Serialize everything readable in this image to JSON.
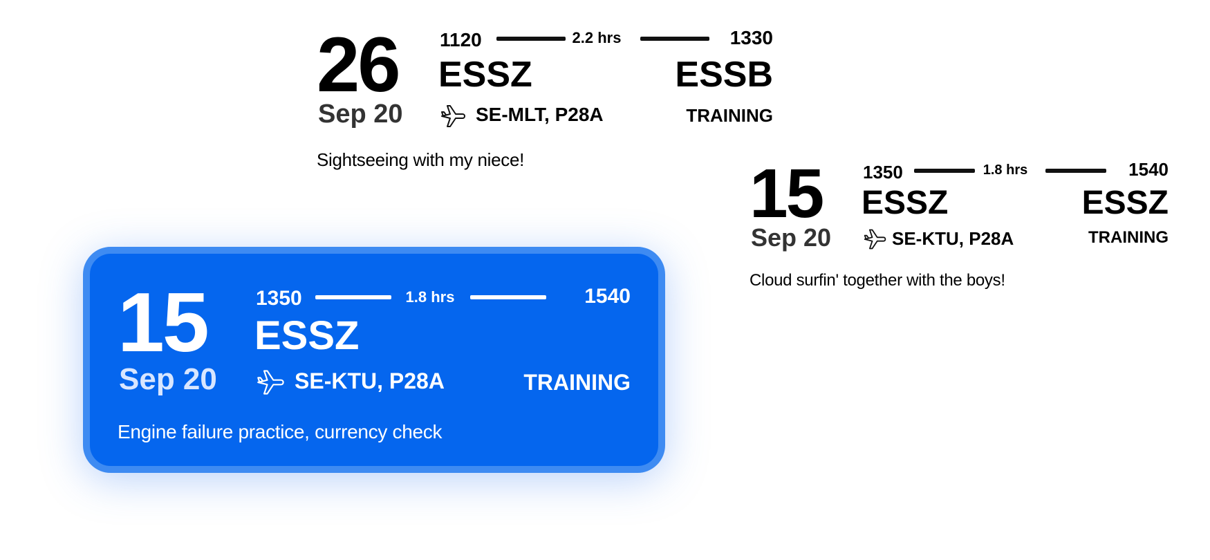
{
  "flights": [
    {
      "day": "26",
      "month": "Sep 20",
      "departure_time": "1120",
      "duration": "2.2 hrs",
      "arrival_time": "1330",
      "departure_code": "ESSZ",
      "arrival_code": "ESSB",
      "aircraft": "SE-MLT, P28A",
      "flight_type": "TRAINING",
      "note": "Sightseeing with my niece!",
      "selected": false
    },
    {
      "day": "15",
      "month": "Sep 20",
      "departure_time": "1350",
      "duration": "1.8 hrs",
      "arrival_time": "1540",
      "departure_code": "ESSZ",
      "arrival_code": "ESSZ",
      "aircraft": "SE-KTU, P28A",
      "flight_type": "TRAINING",
      "note": "Cloud surfin' together with the boys!",
      "selected": false
    },
    {
      "day": "15",
      "month": "Sep 20",
      "departure_time": "1350",
      "duration": "1.8 hrs",
      "arrival_time": "1540",
      "departure_code": "ESSZ",
      "aircraft": "SE-KTU, P28A",
      "flight_type": "TRAINING",
      "note": "Engine failure practice, currency check",
      "selected": true,
      "accent_color": "#0566EE",
      "border_color": "#3E8BF2"
    }
  ],
  "icons": {
    "aircraft": "airplane-icon"
  }
}
